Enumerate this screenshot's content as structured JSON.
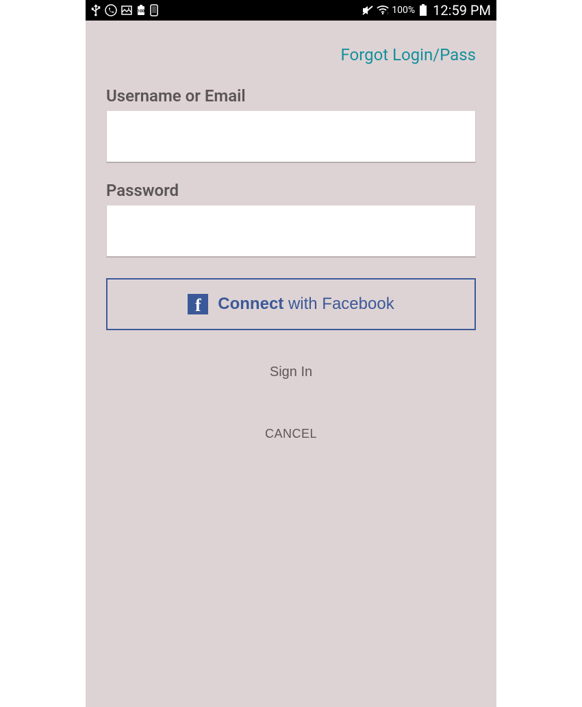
{
  "statusBar": {
    "batteryPercent": "100%",
    "time": "12:59 PM"
  },
  "forgotLink": "Forgot Login/Pass",
  "fields": {
    "username": {
      "label": "Username or Email",
      "value": ""
    },
    "password": {
      "label": "Password",
      "value": ""
    }
  },
  "facebook": {
    "connectBold": "Connect",
    "connectRest": " with Facebook"
  },
  "signIn": "Sign In",
  "cancel": "CANCEL"
}
